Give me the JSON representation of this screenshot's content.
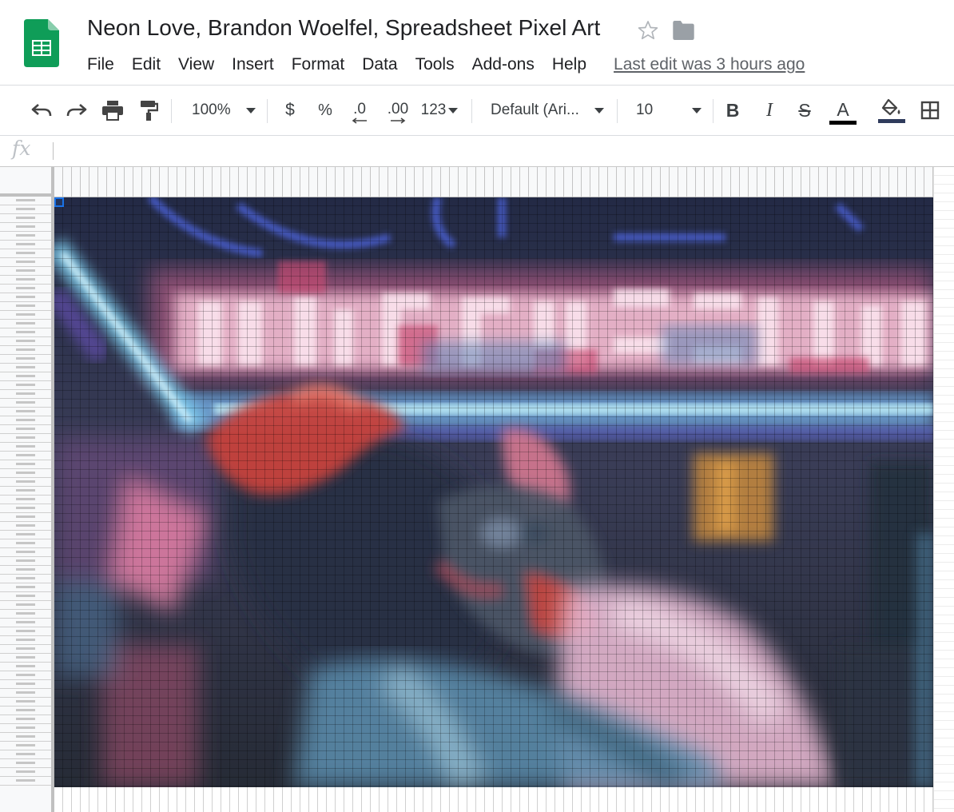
{
  "document": {
    "title": "Neon Love, Brandon Woelfel, Spreadsheet Pixel Art",
    "last_edit": "Last edit was 3 hours ago"
  },
  "menu": [
    "File",
    "Edit",
    "View",
    "Insert",
    "Format",
    "Data",
    "Tools",
    "Add-ons",
    "Help"
  ],
  "toolbar": {
    "zoom": "100%",
    "currency": "$",
    "percent": "%",
    "decrease_decimals": ".0",
    "increase_decimals": ".00",
    "more_formats": "123",
    "font": "Default (Ari...",
    "font_size": "10",
    "bold": "B",
    "italic": "I",
    "strikethrough": "S",
    "text_color_letter": "A",
    "text_color": "#000000",
    "fill_color": "#2f3b5c"
  },
  "formula_bar": {
    "label": "fx",
    "value": ""
  },
  "grid": {
    "last_row_label": "68",
    "selected_cell": "A1"
  },
  "artwork": {
    "sign_text": "ACUPRESSURA",
    "palette": {
      "neon_pink": "#e8a0b8",
      "hot_pink": "#d04f7a",
      "deep_navy": "#2a3040",
      "neon_blue": "#5f6fd6",
      "cyan": "#8fd7f0",
      "skin_red": "#c8453e",
      "warm_orange": "#c88a3a",
      "jacket_blue": "#5d8fa8"
    }
  }
}
